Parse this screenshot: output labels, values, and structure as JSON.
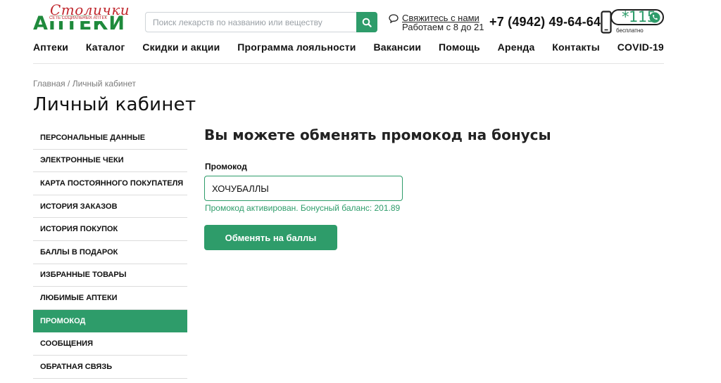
{
  "header": {
    "logo": {
      "script": "Столички",
      "main": "АПТЕКИ",
      "sub": "СЕТЬ СОЦИАЛЬНЫХ АПТЕК"
    },
    "search": {
      "placeholder": "Поиск лекарств по названию или веществу",
      "value": "",
      "button_icon": "search-icon"
    },
    "contact": {
      "icon": "chat-icon",
      "link_text": "Свяжитесь с нами",
      "hours": "Работаем с 8 до 21"
    },
    "phone": "+7 (4942) 49-64-64",
    "short_number": {
      "number": "*115",
      "caption": "бесплатно"
    }
  },
  "nav": {
    "items": [
      "Аптеки",
      "Каталог",
      "Скидки и акции",
      "Программа лояльности",
      "Вакансии",
      "Помощь",
      "Аренда",
      "Контакты",
      "COVID-19"
    ]
  },
  "breadcrumb": {
    "home": "Главная",
    "separator": "/",
    "current": "Личный кабинет"
  },
  "page_title": "Личный кабинет",
  "sidebar": {
    "active_index": 8,
    "items": [
      "ПЕРСОНАЛЬНЫЕ ДАННЫЕ",
      "ЭЛЕКТРОННЫЕ ЧЕКИ",
      "КАРТА ПОСТОЯННОГО ПОКУПАТЕЛЯ",
      "ИСТОРИЯ ЗАКАЗОВ",
      "ИСТОРИЯ ПОКУПОК",
      "БАЛЛЫ В ПОДАРОК",
      "ИЗБРАННЫЕ ТОВАРЫ",
      "ЛЮБИМЫЕ АПТЕКИ",
      "ПРОМОКОД",
      "СООБЩЕНИЯ",
      "ОБРАТНАЯ СВЯЗЬ"
    ]
  },
  "main": {
    "heading": "Вы можете обменять промокод на бонусы",
    "promo_label": "Промокод",
    "promo_value": "ХОЧУБАЛЛЫ",
    "success_message": "Промокод активирован. Бонусный баланс: 201.89",
    "exchange_button": "Обменять на баллы"
  },
  "colors": {
    "accent": "#2e9c6a",
    "logo_green": "#1f8a3c",
    "logo_red": "#c0272d"
  }
}
